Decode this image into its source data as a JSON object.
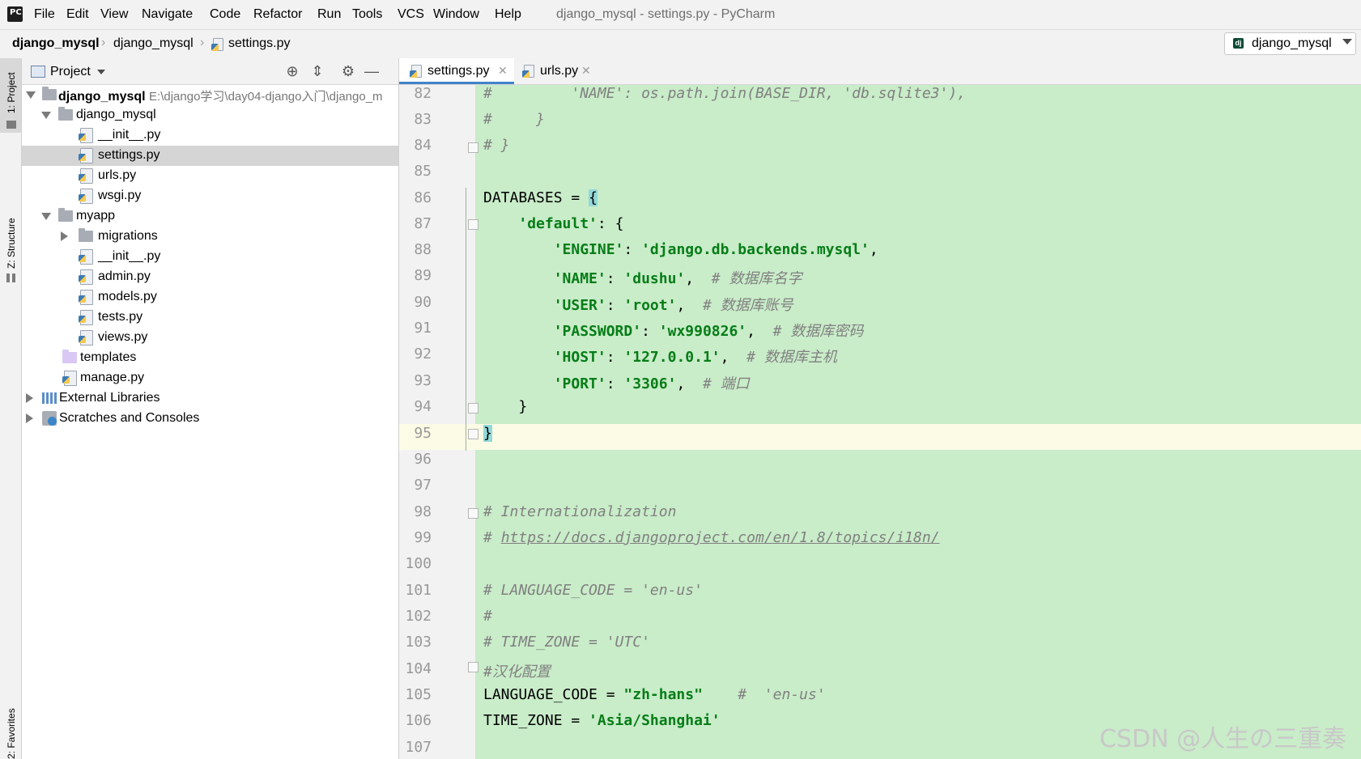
{
  "menubar": {
    "logo": "PC",
    "items": [
      "File",
      "Edit",
      "View",
      "Navigate",
      "Code",
      "Refactor",
      "Run",
      "Tools",
      "VCS",
      "Window",
      "Help"
    ],
    "window_title": "django_mysql - settings.py - PyCharm"
  },
  "navbar": {
    "breadcrumbs": [
      "django_mysql",
      "django_mysql",
      "settings.py"
    ],
    "run_config": {
      "icon": "dj",
      "label": "django_mysql"
    }
  },
  "left_stripe": {
    "tabs": [
      "1: Project",
      "Z: Structure",
      "2: Favorites"
    ]
  },
  "project_panel": {
    "title": "Project",
    "tree": [
      {
        "label": "django_mysql",
        "path": "E:\\django学习\\day04-django入门\\django_m",
        "type": "root"
      },
      {
        "label": "django_mysql",
        "type": "folder"
      },
      {
        "label": "__init__.py",
        "type": "py"
      },
      {
        "label": "settings.py",
        "type": "py",
        "selected": true
      },
      {
        "label": "urls.py",
        "type": "py"
      },
      {
        "label": "wsgi.py",
        "type": "py"
      },
      {
        "label": "myapp",
        "type": "folder"
      },
      {
        "label": "migrations",
        "type": "folder"
      },
      {
        "label": "__init__.py",
        "type": "py"
      },
      {
        "label": "admin.py",
        "type": "py"
      },
      {
        "label": "models.py",
        "type": "py"
      },
      {
        "label": "tests.py",
        "type": "py"
      },
      {
        "label": "views.py",
        "type": "py"
      },
      {
        "label": "templates",
        "type": "template-folder"
      },
      {
        "label": "manage.py",
        "type": "py"
      },
      {
        "label": "External Libraries",
        "type": "libraries"
      },
      {
        "label": "Scratches and Consoles",
        "type": "scratches"
      }
    ]
  },
  "editor": {
    "tabs": [
      {
        "label": "settings.py",
        "active": true
      },
      {
        "label": "urls.py",
        "active": false
      }
    ],
    "current_line": 95,
    "lines": [
      {
        "n": "82",
        "text": "#         'NAME': os.path.join(BASE_DIR, 'db.sqlite3'),"
      },
      {
        "n": "83",
        "text": "#     }"
      },
      {
        "n": "84",
        "text": "# }"
      },
      {
        "n": "85",
        "text": ""
      },
      {
        "n": "86",
        "text": "DATABASES = {"
      },
      {
        "n": "87",
        "text": "    'default': {"
      },
      {
        "n": "88",
        "text": "        'ENGINE': 'django.db.backends.mysql',"
      },
      {
        "n": "89",
        "text": "        'NAME': 'dushu',  # 数据库名字"
      },
      {
        "n": "90",
        "text": "        'USER': 'root',  # 数据库账号"
      },
      {
        "n": "91",
        "text": "        'PASSWORD': 'wx990826',  # 数据库密码"
      },
      {
        "n": "92",
        "text": "        'HOST': '127.0.0.1',  # 数据库主机"
      },
      {
        "n": "93",
        "text": "        'PORT': '3306',  # 端口"
      },
      {
        "n": "94",
        "text": "    }"
      },
      {
        "n": "95",
        "text": "}"
      },
      {
        "n": "96",
        "text": ""
      },
      {
        "n": "97",
        "text": ""
      },
      {
        "n": "98",
        "text": "# Internationalization"
      },
      {
        "n": "99",
        "text": "# https://docs.djangoproject.com/en/1.8/topics/i18n/"
      },
      {
        "n": "100",
        "text": ""
      },
      {
        "n": "101",
        "text": "# LANGUAGE_CODE = 'en-us'"
      },
      {
        "n": "102",
        "text": "#"
      },
      {
        "n": "103",
        "text": "# TIME_ZONE = 'UTC'"
      },
      {
        "n": "104",
        "text": "#汉化配置"
      },
      {
        "n": "105",
        "text": "LANGUAGE_CODE = \"zh-hans\"    #  'en-us'"
      },
      {
        "n": "106",
        "text": "TIME_ZONE = 'Asia/Shanghai'"
      },
      {
        "n": "107",
        "text": ""
      }
    ]
  },
  "watermark": "CSDN @人生の三重奏",
  "colors": {
    "code_background": "#c9ecc9",
    "current_line": "#fcfbe5",
    "string": "#067d17",
    "comment": "#808080",
    "selection": "#d5d5d5",
    "active_tab_underline": "#4083c9"
  }
}
